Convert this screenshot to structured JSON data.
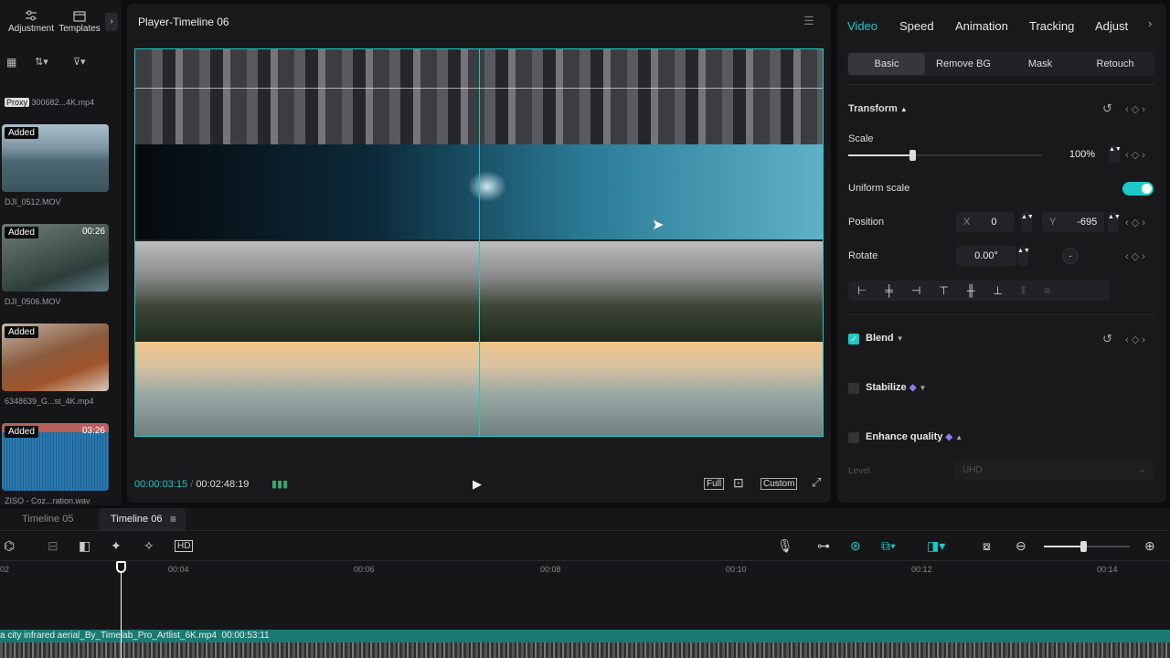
{
  "left_panel": {
    "top_buttons": [
      {
        "label": "Adjustment",
        "icon": "sliders-icon"
      },
      {
        "label": "Templates",
        "icon": "template-icon"
      }
    ],
    "proxy_badge": "Proxy",
    "proxy_file": "300682...4K.mp4",
    "clips": [
      {
        "badge": "Added",
        "duration": "",
        "name": "DJI_0512.MOV"
      },
      {
        "badge": "Added",
        "duration": "00:26",
        "name": "DJI_0506.MOV"
      },
      {
        "badge": "Added",
        "duration": "",
        "name": "6348639_G...st_4K.mp4"
      },
      {
        "badge": "Added",
        "duration": "03:26",
        "name": "ZISO - Coz...ration.wav"
      }
    ]
  },
  "player": {
    "title": "Player-Timeline 06",
    "current_time": "00:00:03:15",
    "total_time": "00:02:48:19",
    "full_label": "Full",
    "custom_label": "Custom"
  },
  "inspector": {
    "tabs": [
      "Video",
      "Speed",
      "Animation",
      "Tracking",
      "Adjust"
    ],
    "active_tab": "Video",
    "subtabs": [
      "Basic",
      "Remove BG",
      "Mask",
      "Retouch"
    ],
    "transform_label": "Transform",
    "scale_label": "Scale",
    "scale_value": "100%",
    "scale_level": 0.33,
    "uniform_scale_label": "Uniform scale",
    "uniform_scale_on": true,
    "position_label": "Position",
    "pos_x_label": "X",
    "pos_x": "0",
    "pos_y_label": "Y",
    "pos_y": "-695",
    "rotate_label": "Rotate",
    "rotate_value": "0.00°",
    "blend_label": "Blend",
    "stabilize_label": "Stabilize",
    "enhance_label": "Enhance quality",
    "level_label": "Level",
    "level_value": "UHD"
  },
  "timeline": {
    "tabs": [
      "Timeline 05",
      "Timeline 06"
    ],
    "active_tab": "Timeline 06",
    "ruler": [
      "02",
      "00:04",
      "00:06",
      "00:08",
      "00:10",
      "00:12",
      "00:14"
    ],
    "clip_label": "a city infrared aerial_By_Timelab_Pro_Artlist_6K.mp4",
    "clip_duration": "00:00:53:11"
  },
  "colors": {
    "accent": "#1ec8c8",
    "bg": "#0d0d0f",
    "panel": "#19191c"
  }
}
